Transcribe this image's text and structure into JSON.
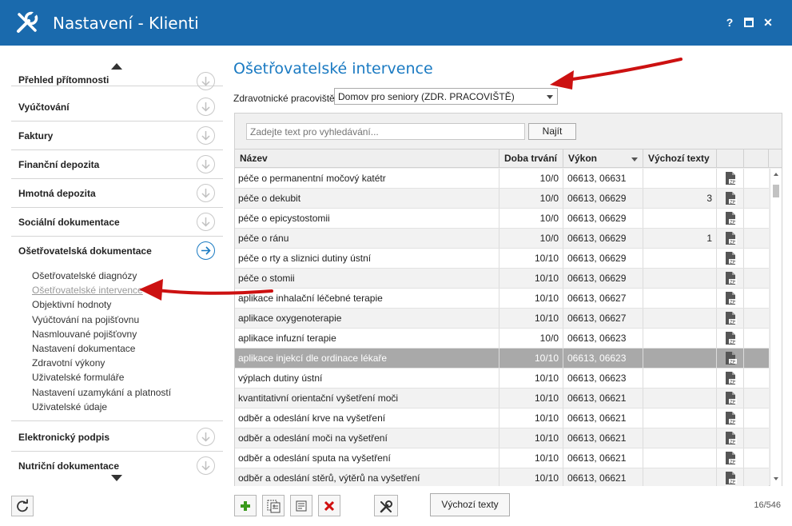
{
  "window": {
    "title": "Nastavení - Klienti",
    "buttons": {
      "help": "?",
      "maximize": "□",
      "close": "✕"
    }
  },
  "sidebar": {
    "items": [
      {
        "label": "Přehled přítomnosti"
      },
      {
        "label": "Vyúčtování"
      },
      {
        "label": "Faktury"
      },
      {
        "label": "Finanční depozita"
      },
      {
        "label": "Hmotná depozita"
      },
      {
        "label": "Sociální dokumentace"
      },
      {
        "label": "Ošetřovatelská dokumentace"
      }
    ],
    "subitems": [
      "Ošetřovatelské diagnózy",
      "Ošetřovatelské intervence",
      "Objektivní hodnoty",
      "Vyúčtování na pojišťovnu",
      "Nasmlouvané pojišťovny",
      "Nastavení dokumentace",
      "Zdravotní výkony",
      "Uživatelské formuláře",
      "Nastavení uzamykání a platností",
      "Uživatelské údaje"
    ],
    "bottom_items": [
      {
        "label": "Elektronický podpis"
      },
      {
        "label": "Nutriční dokumentace"
      }
    ]
  },
  "main": {
    "title": "Ošetřovatelské intervence",
    "workplace_label": "Zdravotnické pracoviště:",
    "workplace_value": "Domov pro seniory (ZDR. PRACOVIŠTĚ)",
    "search_placeholder": "Zadejte text pro vyhledávání...",
    "search_button": "Najít",
    "columns": {
      "name": "Název",
      "duration": "Doba trvání",
      "procedure": "Výkon",
      "default_texts": "Výchozí texty"
    },
    "rows": [
      {
        "name": "péče o permanentní močový katétr",
        "duration": "10/0",
        "procedure": "06613, 06631",
        "default_texts": ""
      },
      {
        "name": "péče o dekubit",
        "duration": "10/0",
        "procedure": "06613, 06629",
        "default_texts": "3"
      },
      {
        "name": "péče o epicystostomii",
        "duration": "10/0",
        "procedure": "06613, 06629",
        "default_texts": ""
      },
      {
        "name": "péče o ránu",
        "duration": "10/0",
        "procedure": "06613, 06629",
        "default_texts": "1"
      },
      {
        "name": "péče o rty a sliznici dutiny ústní",
        "duration": "10/10",
        "procedure": "06613, 06629",
        "default_texts": ""
      },
      {
        "name": "péče o stomii",
        "duration": "10/10",
        "procedure": "06613, 06629",
        "default_texts": ""
      },
      {
        "name": "aplikace inhalační léčebné terapie",
        "duration": "10/10",
        "procedure": "06613, 06627",
        "default_texts": ""
      },
      {
        "name": "aplikace oxygenoterapie",
        "duration": "10/10",
        "procedure": "06613, 06627",
        "default_texts": ""
      },
      {
        "name": "aplikace infuzní terapie",
        "duration": "10/0",
        "procedure": "06613, 06623",
        "default_texts": ""
      },
      {
        "name": "aplikace injekcí dle ordinace lékaře",
        "duration": "10/10",
        "procedure": "06613, 06623",
        "default_texts": ""
      },
      {
        "name": "výplach dutiny ústní",
        "duration": "10/10",
        "procedure": "06613, 06623",
        "default_texts": ""
      },
      {
        "name": "kvantitativní orientační vyšetření moči",
        "duration": "10/10",
        "procedure": "06613, 06621",
        "default_texts": ""
      },
      {
        "name": "odběr a odeslání krve na vyšetření",
        "duration": "10/10",
        "procedure": "06613, 06621",
        "default_texts": ""
      },
      {
        "name": "odběr a odeslání moči na vyšetření",
        "duration": "10/10",
        "procedure": "06613, 06621",
        "default_texts": ""
      },
      {
        "name": "odběr a odeslání sputa na vyšetření",
        "duration": "10/10",
        "procedure": "06613, 06621",
        "default_texts": ""
      },
      {
        "name": "odběr a odeslání stěrů, výtěrů na vyšetření",
        "duration": "10/10",
        "procedure": "06613, 06621",
        "default_texts": ""
      }
    ],
    "selected_row_index": 9,
    "doc_icon_label": "ZP",
    "default_texts_button": "Výchozí texty",
    "record_counter": "16/546"
  },
  "colors": {
    "titlebar": "#1a6aad",
    "accent": "#1a7ac2",
    "selected_row": "#a9a9a9",
    "annotation_arrow": "#cc1111",
    "add_icon": "#3a9a1c",
    "delete_icon": "#d01010"
  },
  "icons": {
    "app": "wrench-screwdriver-icon",
    "nav_collapsed": "arrow-down-circle-icon",
    "nav_expanded": "arrow-right-circle-icon",
    "row_doc": "zip-document-icon",
    "toolbar": [
      "add-icon",
      "copy-icon",
      "edit-icon",
      "delete-icon",
      "tools-icon"
    ],
    "refresh": "refresh-icon"
  }
}
